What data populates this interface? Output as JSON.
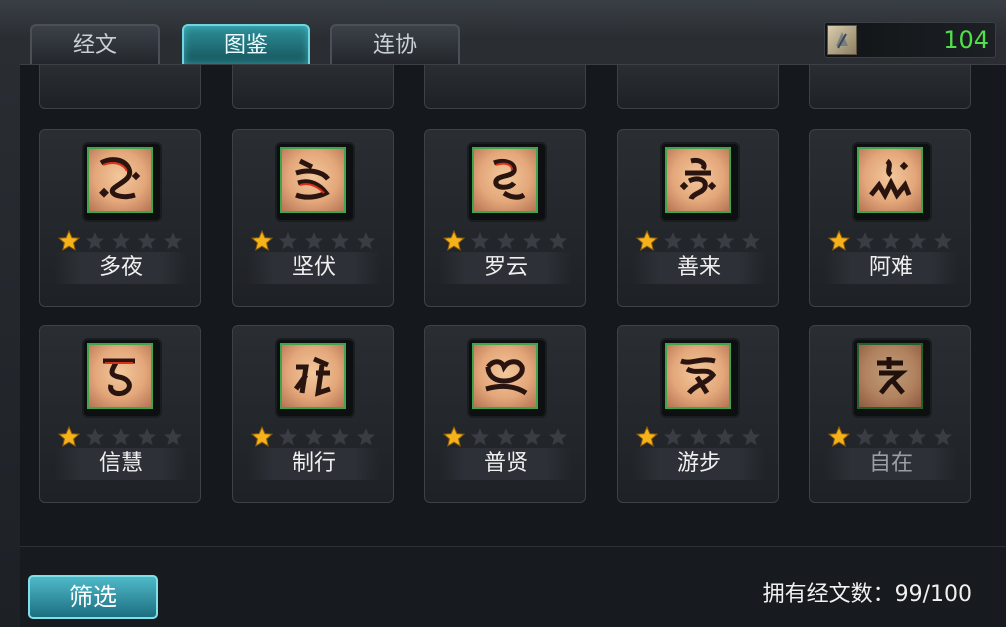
{
  "tabs": [
    {
      "label": "经文"
    },
    {
      "label": "图鉴"
    },
    {
      "label": "连协"
    }
  ],
  "currency": {
    "icon": "scroll-icon",
    "value": "104"
  },
  "cards": [
    {
      "name": "多夜",
      "stars_filled": 1,
      "stars_total": 5
    },
    {
      "name": "坚伏",
      "stars_filled": 1,
      "stars_total": 5
    },
    {
      "name": "罗云",
      "stars_filled": 1,
      "stars_total": 5
    },
    {
      "name": "善来",
      "stars_filled": 1,
      "stars_total": 5
    },
    {
      "name": "阿难",
      "stars_filled": 1,
      "stars_total": 5
    },
    {
      "name": "信慧",
      "stars_filled": 1,
      "stars_total": 5
    },
    {
      "name": "制行",
      "stars_filled": 1,
      "stars_total": 5
    },
    {
      "name": "普贤",
      "stars_filled": 1,
      "stars_total": 5
    },
    {
      "name": "游步",
      "stars_filled": 1,
      "stars_total": 5
    },
    {
      "name": "自在",
      "stars_filled": 1,
      "stars_total": 5,
      "owned": false
    }
  ],
  "footer": {
    "filter_label": "筛选",
    "owned_label": "拥有经文数：99/100"
  },
  "colors": {
    "active_tab": "#2e8f98",
    "currency_text": "#4fe04a",
    "icon_border": "#3fa54c",
    "star_filled": "#f5b21a",
    "star_empty": "#3a3e44"
  }
}
